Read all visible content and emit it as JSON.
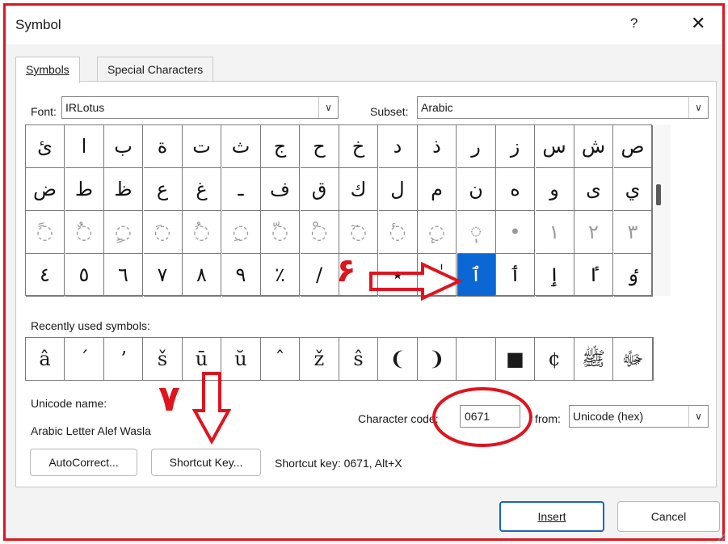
{
  "dialog": {
    "title": "Symbol",
    "help": "?",
    "close": "✕"
  },
  "tabs": [
    {
      "label": "Symbols",
      "active": true
    },
    {
      "label": "Special Characters",
      "active": false
    }
  ],
  "font": {
    "label": "Font:",
    "value": "IRLotus"
  },
  "subset": {
    "label": "Subset:",
    "value": "Arabic"
  },
  "grid": {
    "rows": [
      [
        "ئ",
        "ا",
        "ب",
        "ة",
        "ت",
        "ث",
        "ج",
        "ح",
        "خ",
        "د",
        "ذ",
        "ر",
        "ز",
        "س",
        "ش",
        "ص"
      ],
      [
        "ض",
        "ط",
        "ظ",
        "ع",
        "غ",
        "ـ",
        "ف",
        "ق",
        "ك",
        "ل",
        "م",
        "ن",
        "ه",
        "و",
        "ى",
        "ي"
      ],
      [
        "◌ً",
        "◌ٌ",
        "◌ٍ",
        "◌َ",
        "◌ُ",
        "◌ِ",
        "◌ّ",
        "◌ْ",
        "◌ٓ",
        "◌ٔ",
        "◌ٕ",
        "◌ٖ",
        "•",
        "١",
        "٢",
        "٣"
      ],
      [
        "٤",
        "٥",
        "٦",
        "٧",
        "٨",
        "٩",
        "٪",
        "/",
        "",
        "٭",
        "ٰ",
        "ٱ",
        "ٲ",
        "ٳ",
        "ٵ",
        "ٶ"
      ]
    ],
    "faint_row": 2,
    "selected": {
      "row": 3,
      "col": 11
    }
  },
  "recent": {
    "label": "Recently used symbols:",
    "items": [
      "â",
      "ˊ",
      "ʼ",
      "š",
      "ū",
      "ŭ",
      "ˆ",
      "ž",
      "ŝ",
      "❨",
      "❩",
      "",
      "■",
      "¢",
      "ﷺ",
      "ﷻ"
    ]
  },
  "unicode": {
    "label": "Unicode name:",
    "name": "Arabic Letter Alef Wasla"
  },
  "charcode": {
    "label": "Character code:",
    "value": "0671"
  },
  "from": {
    "label": "from:",
    "value": "Unicode (hex)"
  },
  "buttons": {
    "autocorrect": "AutoCorrect...",
    "shortcut_key": "Shortcut Key...",
    "insert": "Insert",
    "cancel": "Cancel"
  },
  "shortcut_text": "Shortcut key: 0671, Alt+X",
  "annotations": {
    "six": "۶",
    "seven": "٧"
  },
  "colors": {
    "accent": "#0a67d3",
    "annotation": "#e0141e"
  }
}
